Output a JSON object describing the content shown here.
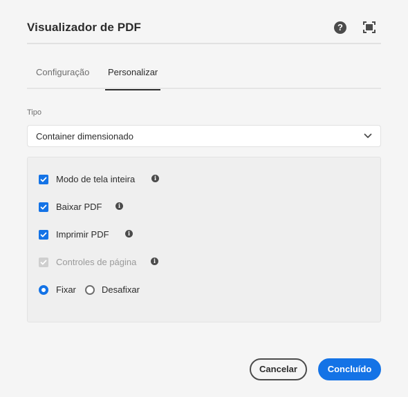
{
  "dialog": {
    "title": "Visualizador de PDF",
    "help_icon": "help-icon",
    "fullscreen_icon": "fullscreen-icon"
  },
  "tabs": [
    {
      "label": "Configuração",
      "active": false
    },
    {
      "label": "Personalizar",
      "active": true
    }
  ],
  "tipo": {
    "label": "Tipo",
    "value": "Container dimensionado"
  },
  "options": [
    {
      "label": "Modo de tela inteira",
      "checked": true,
      "disabled": false
    },
    {
      "label": "Baixar PDF",
      "checked": true,
      "disabled": false
    },
    {
      "label": "Imprimir PDF",
      "checked": true,
      "disabled": false
    },
    {
      "label": "Controles de página",
      "checked": true,
      "disabled": true
    }
  ],
  "dock": {
    "options": [
      {
        "label": "Fixar",
        "selected": true
      },
      {
        "label": "Desafixar",
        "selected": false
      }
    ]
  },
  "footer": {
    "cancel_label": "Cancelar",
    "done_label": "Concluído"
  },
  "colors": {
    "accent": "#1473e6",
    "background": "#f5f5f5"
  }
}
